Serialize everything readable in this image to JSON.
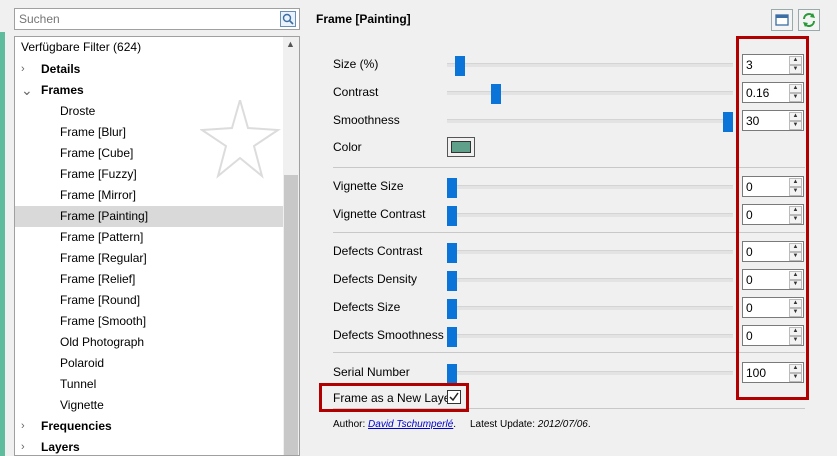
{
  "search": {
    "placeholder": "Suchen"
  },
  "tree": {
    "header": "Verfügbare Filter (624)",
    "items": [
      {
        "label": "Details",
        "type": "group",
        "expanded": false
      },
      {
        "label": "Frames",
        "type": "group",
        "expanded": true
      },
      {
        "label": "Droste",
        "type": "child"
      },
      {
        "label": "Frame [Blur]",
        "type": "child"
      },
      {
        "label": "Frame [Cube]",
        "type": "child"
      },
      {
        "label": "Frame [Fuzzy]",
        "type": "child"
      },
      {
        "label": "Frame [Mirror]",
        "type": "child"
      },
      {
        "label": "Frame [Painting]",
        "type": "child",
        "selected": true
      },
      {
        "label": "Frame [Pattern]",
        "type": "child"
      },
      {
        "label": "Frame [Regular]",
        "type": "child"
      },
      {
        "label": "Frame [Relief]",
        "type": "child"
      },
      {
        "label": "Frame [Round]",
        "type": "child"
      },
      {
        "label": "Frame [Smooth]",
        "type": "child"
      },
      {
        "label": "Old Photograph",
        "type": "child"
      },
      {
        "label": "Polaroid",
        "type": "child"
      },
      {
        "label": "Tunnel",
        "type": "child"
      },
      {
        "label": "Vignette",
        "type": "child"
      },
      {
        "label": "Frequencies",
        "type": "group",
        "expanded": false
      },
      {
        "label": "Layers",
        "type": "group",
        "expanded": false
      }
    ]
  },
  "filter": {
    "title": "Frame [Painting]",
    "params": [
      {
        "label": "Size (%)",
        "value": "3",
        "fraction": 0.03
      },
      {
        "label": "Contrast",
        "value": "0.16",
        "fraction": 0.16
      },
      {
        "label": "Smoothness",
        "value": "30",
        "fraction": 1.0
      },
      {
        "label": "Color",
        "type": "color",
        "color": "#5fa08a"
      },
      {
        "label": "Vignette Size",
        "value": "0",
        "fraction": 0
      },
      {
        "label": "Vignette Contrast",
        "value": "0",
        "fraction": 0
      },
      {
        "label": "Defects Contrast",
        "value": "0",
        "fraction": 0
      },
      {
        "label": "Defects Density",
        "value": "0",
        "fraction": 0
      },
      {
        "label": "Defects Size",
        "value": "0",
        "fraction": 0
      },
      {
        "label": "Defects Smoothness",
        "value": "0",
        "fraction": 0
      },
      {
        "label": "Serial Number",
        "value": "100",
        "fraction": 0
      }
    ],
    "new_layer_label": "Frame as a New Layer",
    "new_layer_checked": true,
    "author_prefix": "Author:",
    "author": "David Tschumperlé",
    "author_suffix": ".",
    "update_prefix": "Latest Update:",
    "update_date": "2012/07/06",
    "update_suffix": "."
  },
  "colors": {
    "accent": "#5fbd9d",
    "slider": "#0a74d8",
    "highlight": "#b20000",
    "selected_row": "#d9d9d9"
  },
  "icons": [
    "search-icon",
    "window-icon",
    "refresh-icon",
    "check-icon",
    "watermark-star-icon"
  ]
}
